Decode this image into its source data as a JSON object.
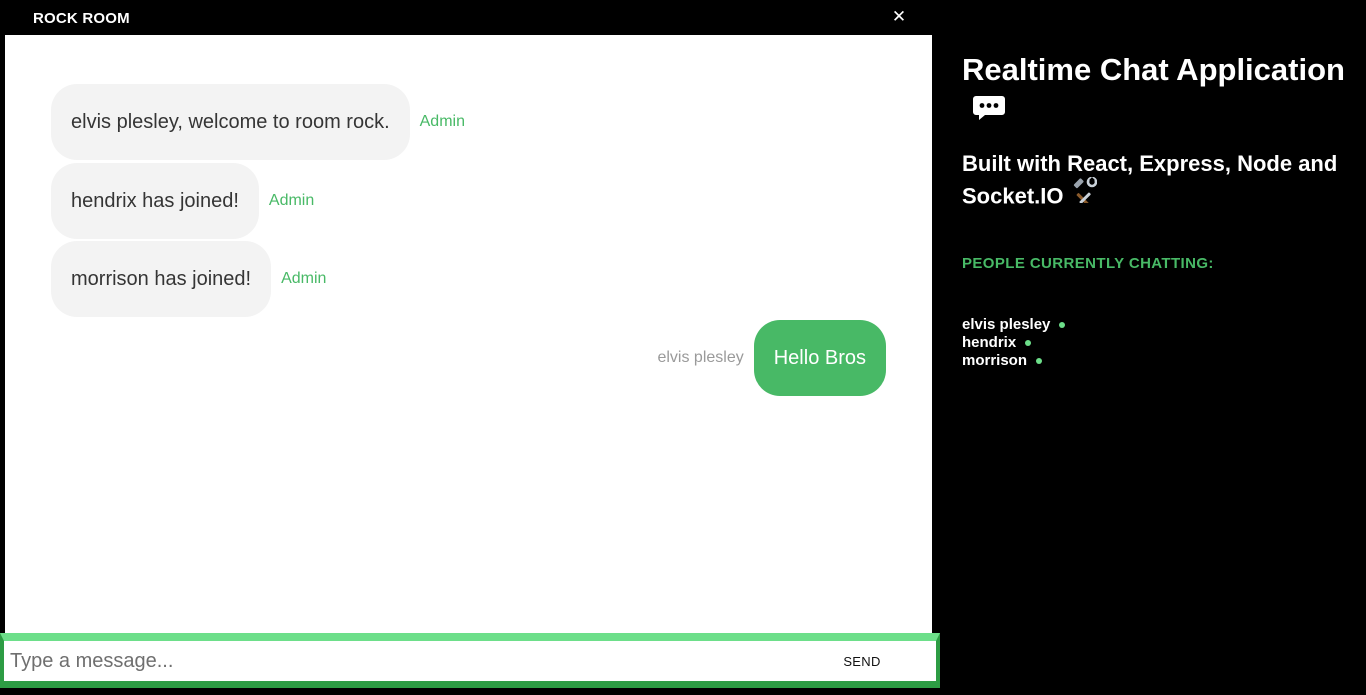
{
  "room": {
    "name": "ROCK ROOM",
    "close_label": "✕"
  },
  "messages": [
    {
      "text": "elvis plesley, welcome to room rock.",
      "sender": "Admin",
      "own": false
    },
    {
      "text": "hendrix has joined!",
      "sender": "Admin",
      "own": false
    },
    {
      "text": "morrison has joined!",
      "sender": "Admin",
      "own": false
    },
    {
      "text": "Hello Bros",
      "sender": "elvis plesley",
      "own": true
    }
  ],
  "composer": {
    "placeholder": "Type a message...",
    "send_label": "SEND"
  },
  "info": {
    "title": "Realtime Chat Application",
    "built_with": "Built with React, Express, Node and Socket.IO",
    "people_heading": "PEOPLE CURRENTLY CHATTING:",
    "people": [
      "elvis plesley",
      "hendrix",
      "morrison"
    ]
  },
  "icons": {
    "close": "close-icon",
    "chat": "speech-bubble-icon",
    "tools": "hammer-wrench-icon",
    "online": "online-dot-icon"
  },
  "colors": {
    "accent_green": "#48b966",
    "input_border_top": "#6ddf8a",
    "input_border": "#2d9c44",
    "bubble_other": "#f3f3f3",
    "background": "#000000"
  }
}
